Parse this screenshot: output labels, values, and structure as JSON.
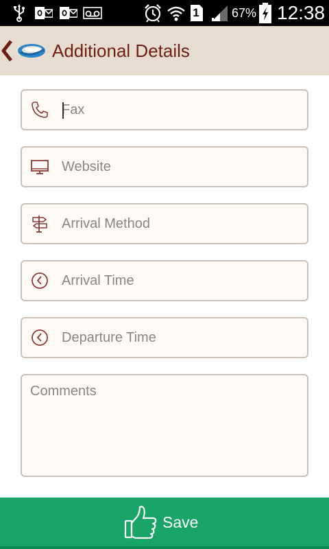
{
  "status_bar": {
    "battery": "67%",
    "time": "12:38",
    "sim_slot": "1",
    "icons": [
      "usb-icon",
      "outlook-icon",
      "outlook-icon",
      "voicemail-icon",
      "alarm-icon",
      "wifi-icon",
      "sim-icon",
      "signal-icon",
      "battery-charging-icon"
    ]
  },
  "header": {
    "title": "Additional Details",
    "title_color": "#6d1f16",
    "background": "#e6ddd0"
  },
  "form": {
    "fax_placeholder": "Fax",
    "website_placeholder": "Website",
    "arrival_method_placeholder": "Arrival Method",
    "arrival_time_placeholder": "Arrival Time",
    "departure_time_placeholder": "Departure Time",
    "comments_placeholder": "Comments"
  },
  "footer": {
    "save_label": "Save",
    "background": "#18a567"
  }
}
